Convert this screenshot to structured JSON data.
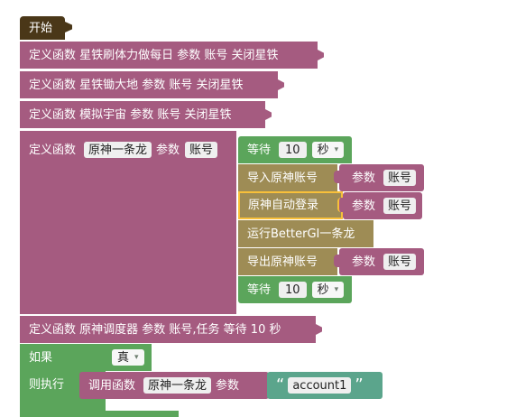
{
  "blocks": {
    "start": "开始",
    "def1": "定义函数 星铁刷体力做每日 参数 账号 关闭星铁",
    "def2": "定义函数 星铁锄大地 参数 账号 关闭星铁",
    "def3": "定义函数 模拟宇宙 参数 账号 关闭星铁",
    "def4_prefix": "定义函数",
    "def4_name": "原神一条龙",
    "def4_param_label": "参数",
    "def4_param": "账号",
    "wait_label": "等待",
    "wait_value": "10",
    "wait_unit": "秒",
    "import_account": "导入原神账号",
    "param_label": "参数",
    "param_account": "账号",
    "auto_login": "原神自动登录",
    "run_bettergi": "运行BetterGI一条龙",
    "export_account": "导出原神账号",
    "wait2_label": "等待",
    "wait2_value": "10",
    "wait2_unit": "秒",
    "def5": "定义函数 原神调度器 参数 账号,任务 等待 10 秒",
    "if_label": "如果",
    "true_value": "真",
    "then_label": "则执行",
    "call_label": "调用函数",
    "call_name": "原神一条龙",
    "call_param_label": "参数",
    "string_value": "account1",
    "quote_open": "“",
    "quote_close": "”"
  },
  "colors": {
    "procedure": "#a55b80",
    "action": "#9e8c55",
    "logic": "#5ba55b",
    "event": "#4a3718",
    "text": "#5ba58c",
    "highlight": "#f8c03a"
  }
}
